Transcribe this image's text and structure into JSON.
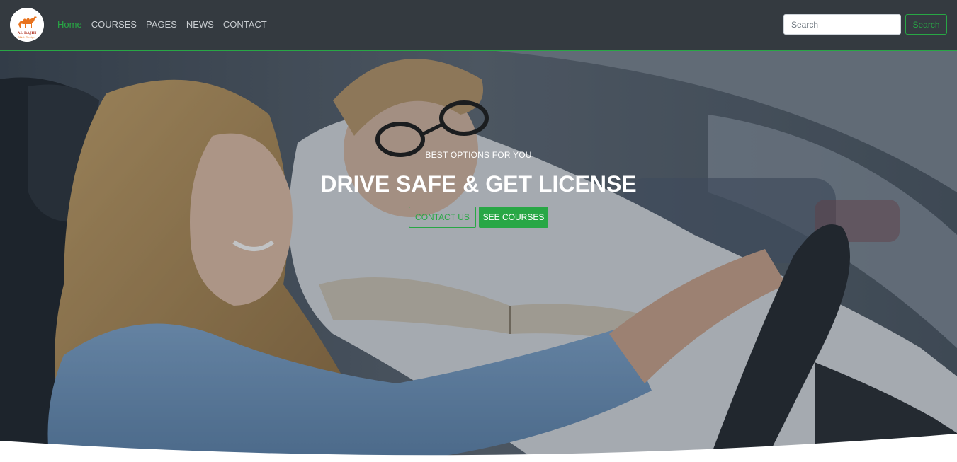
{
  "brand": {
    "logo_text_top": "AL RAJIH",
    "logo_text_bottom": "Web Design"
  },
  "nav": {
    "items": [
      {
        "label": "Home",
        "active": true
      },
      {
        "label": "COURSES",
        "active": false
      },
      {
        "label": "PAGES",
        "active": false
      },
      {
        "label": "NEWS",
        "active": false
      },
      {
        "label": "CONTACT",
        "active": false
      }
    ]
  },
  "search": {
    "placeholder": "Search",
    "button_label": "Search"
  },
  "hero": {
    "eyebrow": "BEST OPTIONS FOR YOU",
    "title": "DRIVE SAFE & GET LICENSE",
    "contact_button": "CONTACT US",
    "courses_button": "SEE COURSES",
    "image_subject": "woman-driving-with-instructor"
  },
  "colors": {
    "accent": "#28a745",
    "navbar_bg": "#343a40",
    "hero_text": "#ffffff"
  },
  "icons": [
    "camel-logo-icon"
  ]
}
